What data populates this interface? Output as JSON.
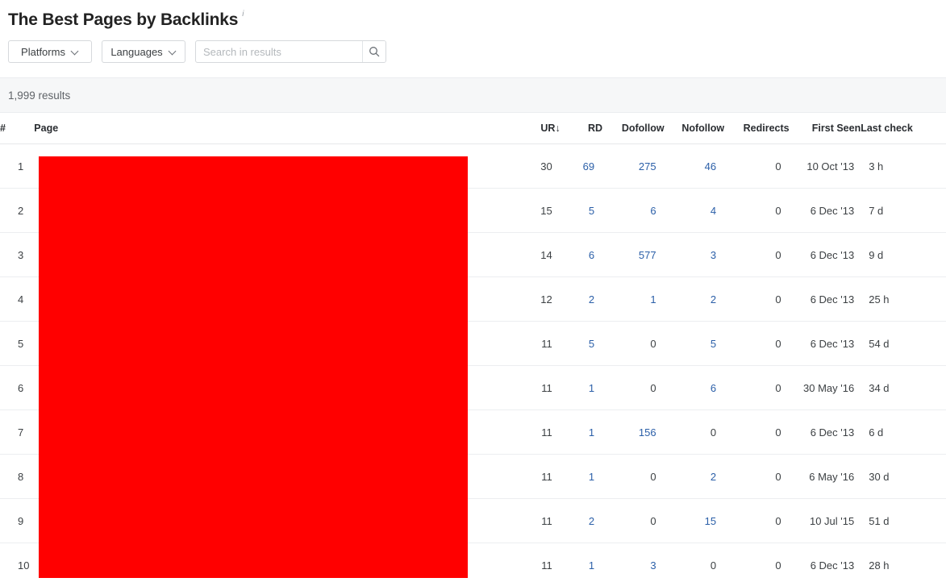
{
  "header": {
    "title": "The Best Pages by Backlinks",
    "info_icon": "info-icon",
    "info_glyph": "i"
  },
  "filters": {
    "platforms_label": "Platforms",
    "languages_label": "Languages",
    "search_placeholder": "Search in results",
    "search_value": "",
    "search_icon": "search-icon"
  },
  "results": {
    "count_text": "1,999 results"
  },
  "table": {
    "columns": [
      {
        "key": "num",
        "label": "#"
      },
      {
        "key": "page",
        "label": "Page"
      },
      {
        "key": "ur",
        "label": "UR",
        "sort": "↓"
      },
      {
        "key": "rd",
        "label": "RD"
      },
      {
        "key": "do",
        "label": "Dofollow"
      },
      {
        "key": "no",
        "label": "Nofollow"
      },
      {
        "key": "re",
        "label": "Redirects"
      },
      {
        "key": "fs",
        "label": "First Seen"
      },
      {
        "key": "lc",
        "label": "Last check"
      }
    ],
    "rows": [
      {
        "num": "1",
        "page": "",
        "ur": "30",
        "rd": "69",
        "do": "275",
        "no": "46",
        "re": "0",
        "fs": "10 Oct '13",
        "lc": "3 h"
      },
      {
        "num": "2",
        "page": "",
        "ur": "15",
        "rd": "5",
        "do": "6",
        "no": "4",
        "re": "0",
        "fs": "6 Dec '13",
        "lc": "7 d"
      },
      {
        "num": "3",
        "page": "",
        "ur": "14",
        "rd": "6",
        "do": "577",
        "no": "3",
        "re": "0",
        "fs": "6 Dec '13",
        "lc": "9 d"
      },
      {
        "num": "4",
        "page": "",
        "ur": "12",
        "rd": "2",
        "do": "1",
        "no": "2",
        "re": "0",
        "fs": "6 Dec '13",
        "lc": "25 h"
      },
      {
        "num": "5",
        "page": "",
        "ur": "11",
        "rd": "5",
        "do": "0",
        "no": "5",
        "re": "0",
        "fs": "6 Dec '13",
        "lc": "54 d"
      },
      {
        "num": "6",
        "page": "",
        "ur": "11",
        "rd": "1",
        "do": "0",
        "no": "6",
        "re": "0",
        "fs": "30 May '16",
        "lc": "34 d"
      },
      {
        "num": "7",
        "page": "",
        "ur": "11",
        "rd": "1",
        "do": "156",
        "no": "0",
        "re": "0",
        "fs": "6 Dec '13",
        "lc": "6 d"
      },
      {
        "num": "8",
        "page": "",
        "ur": "11",
        "rd": "1",
        "do": "0",
        "no": "2",
        "re": "0",
        "fs": "6 May '16",
        "lc": "30 d"
      },
      {
        "num": "9",
        "page": "",
        "ur": "11",
        "rd": "2",
        "do": "0",
        "no": "15",
        "re": "0",
        "fs": "10 Jul '15",
        "lc": "51 d"
      },
      {
        "num": "10",
        "page": "",
        "ur": "11",
        "rd": "1",
        "do": "3",
        "no": "0",
        "re": "0",
        "fs": "6 Dec '13",
        "lc": "28 h"
      }
    ]
  },
  "redaction": {
    "color": "#FF0000"
  }
}
